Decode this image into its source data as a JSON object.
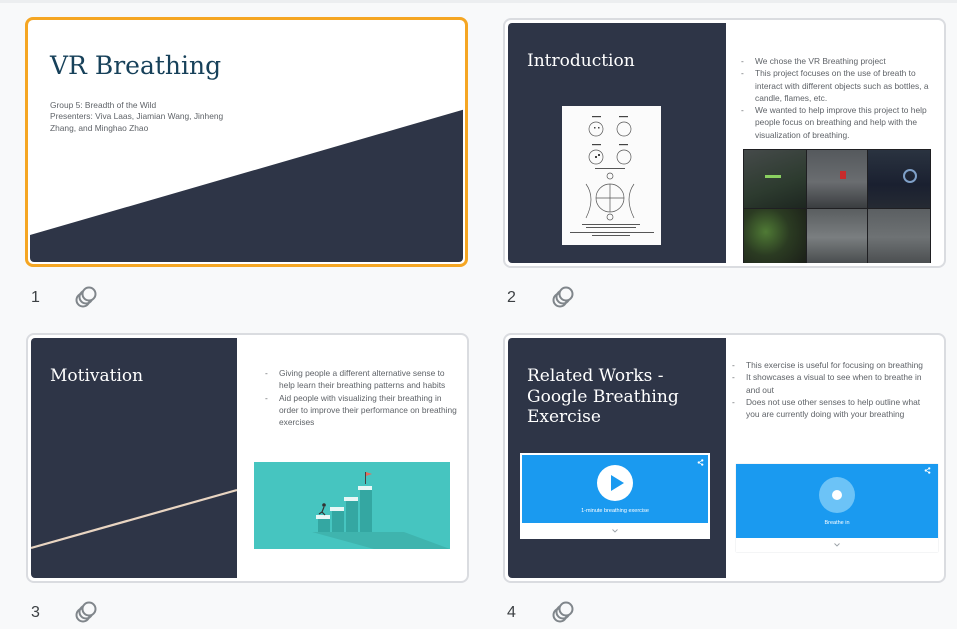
{
  "slides": [
    {
      "number": "1",
      "title": "VR Breathing",
      "subtitle_lines": [
        "Group 5: Breadth of the Wild",
        "Presenters: Viva Laas, Jiamian Wang, Jinheng",
        "Zhang, and Minghao Zhao"
      ]
    },
    {
      "number": "2",
      "title": "Introduction",
      "bullets": [
        "We chose the VR Breathing project",
        "This project focuses on the use of breath to interact with different objects such as bottles, a candle, flames, etc.",
        "We wanted to help improve this project to help people focus on breathing and help with the visualization of breathing."
      ]
    },
    {
      "number": "3",
      "title": "Motivation",
      "bullets": [
        "Giving people a different alternative sense to help learn their breathing patterns and habits",
        "Aid people with visualizing their breathing in order to improve their performance on breathing exercises"
      ]
    },
    {
      "number": "4",
      "title_lines": [
        "Related Works -",
        "Google Breathing",
        "Exercise"
      ],
      "bullets": [
        "This exercise is useful for focusing on breathing",
        "It showcases a visual to see when to breathe in and out",
        "Does not use other senses to help outline what you are currently doing with your breathing"
      ],
      "video_caption": "1-minute breathing exercise",
      "breathe_caption": "Breathe in"
    }
  ],
  "colors": {
    "slide_dark": "#2e3547",
    "selected_border": "#f5a623",
    "title_blue": "#17415a",
    "google_blue": "#1a9af0"
  },
  "icons": {
    "speaker_notes": "stacked-circles-icon",
    "share": "share-icon",
    "play": "play-icon",
    "expand": "chevron-down-icon"
  }
}
